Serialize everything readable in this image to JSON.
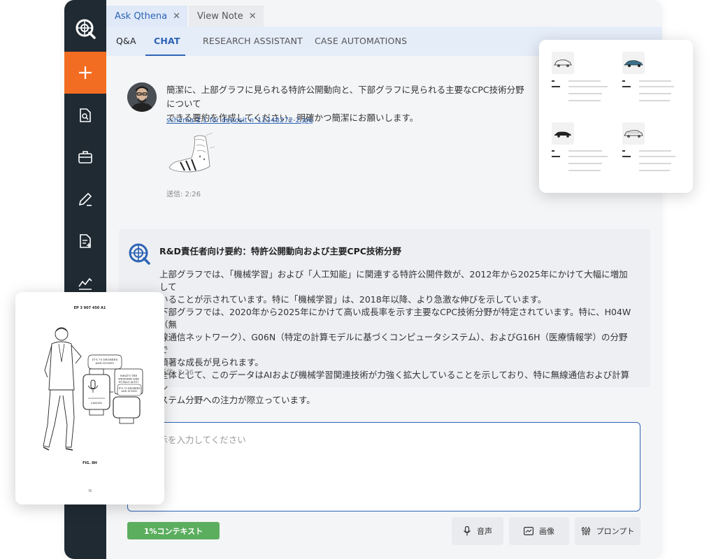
{
  "tabs": [
    {
      "label": "Ask Qthena",
      "active": true
    },
    {
      "label": "View Note",
      "active": false
    }
  ],
  "nav": {
    "qa": "Q&A",
    "chat": "CHAT",
    "research": "RESEARCH ASSISTANT",
    "case": "CASE AUTOMATIONS"
  },
  "user_message": {
    "text_line1": "簡潔に、上部グラフに見られる特許公開動向と、下部グラフに見られる主要なCPC技術分野について",
    "text_line2": "できる要約を作成してください。明確かつ簡潔にお願いします。",
    "attachment": "schema-2.1 for deposit n°12348272-2.jpg",
    "time": "送信: 2:26"
  },
  "answer": {
    "title": "R&D責任者向け要約：特許公開動向および主要CPC技術分野",
    "line1": "上部グラフでは、「機械学習」および「人工知能」に関連する特許公開件数が、2012年から2025年にかけて大幅に増加して",
    "line2": "いることが示されています。特に「機械学習」は、2018年以降、より急激な伸びを示しています。",
    "line3": "下部グラフでは、2020年から2025年にかけて高い成長率を示す主要なCPC技術分野が特定されています。特に、H04W（無",
    "line4": "線通信ネットワーク）、G06N（特定の計算モデルに基づくコンピュータシステム）、およびG16H（医療情報学）の分野で",
    "line5": "顕著な成長が見られます。",
    "line6": "全体として、このデータはAIおよび機械学習関連技術が力強く拡大していることを示しており、特に無線通信および計算シ",
    "line7": "ステム分野への注力が際立っています。",
    "time": "送信: 2:26"
  },
  "prompt": {
    "placeholder": "指示を入力してください"
  },
  "footer": {
    "context": "1%コンテキスト",
    "voice": "音声",
    "image": "画像",
    "prompt": "プロンプト"
  },
  "patent_overlay": {
    "header": "EP 3 907 450 A1",
    "bubble1": "IT'S 70 DEGREES AND SUNNY.",
    "bubble2": "WHAT'S THE WEATHER LIKE IN PALO ALTO?",
    "bubble3": "IT'S 70 DEGREES AND SUNNY.",
    "cancel": "CANCEL",
    "fig": "FIG. 8H",
    "page": "76"
  },
  "colors": {
    "sidebar": "#1f2a33",
    "accent_orange": "#f26d21",
    "accent_blue": "#2d63b4",
    "context_green": "#5cae5f"
  },
  "icons": {
    "sidebar": [
      "document-search-icon",
      "briefcase-icon",
      "pen-icon",
      "document-add-icon",
      "chart-line-icon"
    ],
    "footer": [
      "microphone-icon",
      "image-icon",
      "sliders-icon"
    ]
  }
}
